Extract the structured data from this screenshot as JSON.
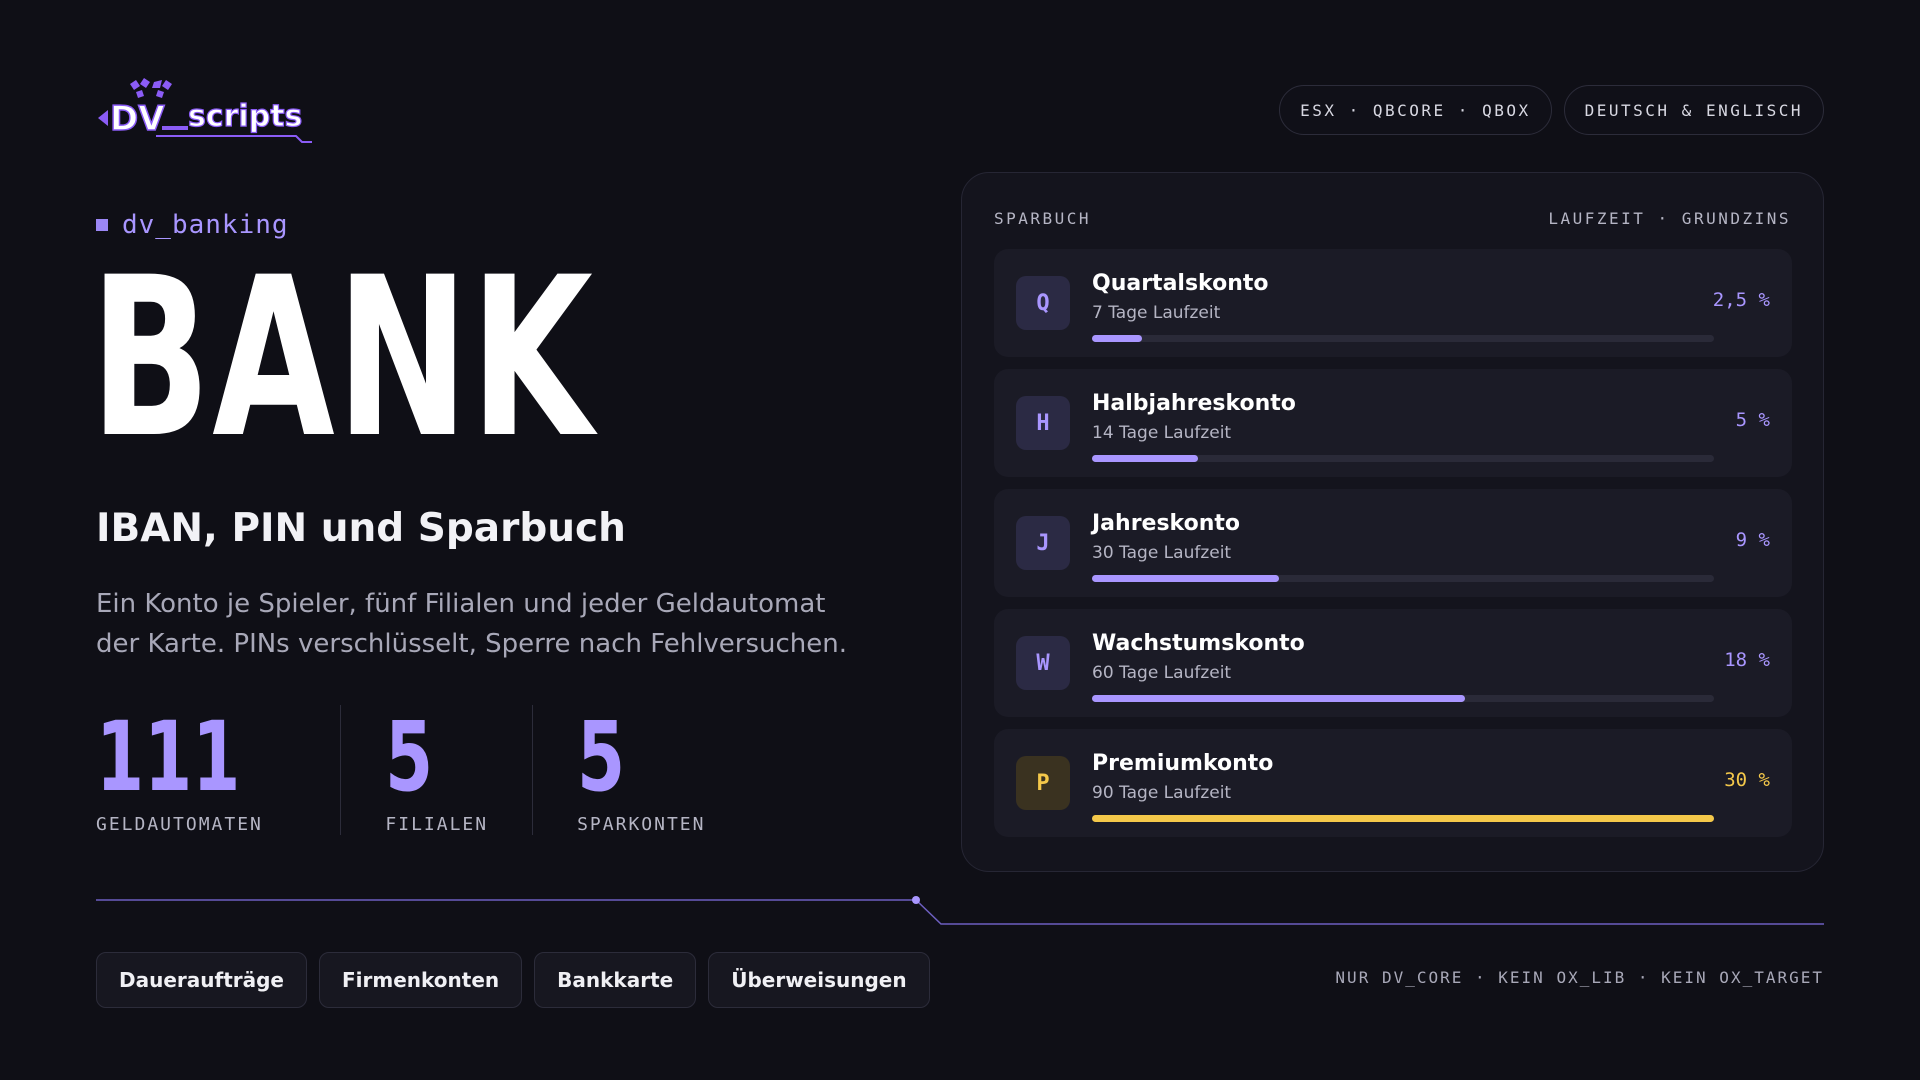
{
  "logo": {
    "name": "DV_scripts"
  },
  "header": {
    "frameworks": "ESX · QBCORE · QBOX",
    "languages": "DEUTSCH & ENGLISCH"
  },
  "tag": "dv_banking",
  "title": "BANK",
  "subtitle": "IBAN, PIN und Sparbuch",
  "description": "Ein Konto je Spieler, fünf Filialen und jeder Geldautomat der Karte. PINs verschlüsselt, Sperre nach Fehlversuchen.",
  "stats": [
    {
      "value": "111",
      "label": "GELDAUTOMATEN"
    },
    {
      "value": "5",
      "label": "FILIALEN"
    },
    {
      "value": "5",
      "label": "SPARKONTEN"
    }
  ],
  "sparbuch": {
    "heading": "SPARBUCH",
    "columns": "LAUFZEIT · GRUNDZINS",
    "accounts": [
      {
        "letter": "Q",
        "name": "Quartalskonto",
        "term": "7 Tage Laufzeit",
        "rate": "2,5 %",
        "level": 0.08,
        "highlight": false
      },
      {
        "letter": "H",
        "name": "Halbjahreskonto",
        "term": "14 Tage Laufzeit",
        "rate": "5 %",
        "level": 0.17,
        "highlight": false
      },
      {
        "letter": "J",
        "name": "Jahreskonto",
        "term": "30 Tage Laufzeit",
        "rate": "9 %",
        "level": 0.3,
        "highlight": false
      },
      {
        "letter": "W",
        "name": "Wachstumskonto",
        "term": "60 Tage Laufzeit",
        "rate": "18 %",
        "level": 0.6,
        "highlight": false
      },
      {
        "letter": "P",
        "name": "Premiumkonto",
        "term": "90 Tage Laufzeit",
        "rate": "30 %",
        "level": 1.0,
        "highlight": true
      }
    ]
  },
  "features": [
    "Daueraufträge",
    "Firmenkonten",
    "Bankkarte",
    "Überweisungen"
  ],
  "footer_note": "NUR DV_CORE · KEIN OX_LIB · KEIN OX_TARGET",
  "colors": {
    "accent": "#a996ff",
    "gold": "#f4c84a",
    "background": "#0f0f16"
  }
}
